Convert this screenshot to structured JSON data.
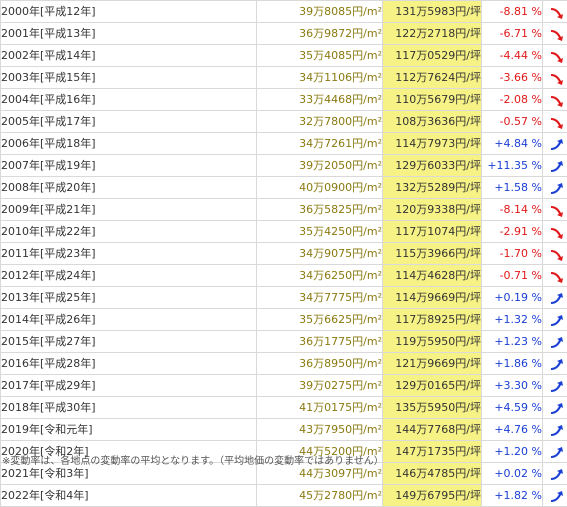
{
  "rows": [
    {
      "year": "2000年[平成12年]",
      "per_sqm": "39万8085円/m²",
      "per_tsubo": "131万5983円/坪",
      "rate": "-8.81 %",
      "trend": "down"
    },
    {
      "year": "2001年[平成13年]",
      "per_sqm": "36万9872円/m²",
      "per_tsubo": "122万2718円/坪",
      "rate": "-6.71 %",
      "trend": "down"
    },
    {
      "year": "2002年[平成14年]",
      "per_sqm": "35万4085円/m²",
      "per_tsubo": "117万0529円/坪",
      "rate": "-4.44 %",
      "trend": "down"
    },
    {
      "year": "2003年[平成15年]",
      "per_sqm": "34万1106円/m²",
      "per_tsubo": "112万7624円/坪",
      "rate": "-3.66 %",
      "trend": "down"
    },
    {
      "year": "2004年[平成16年]",
      "per_sqm": "33万4468円/m²",
      "per_tsubo": "110万5679円/坪",
      "rate": "-2.08 %",
      "trend": "down"
    },
    {
      "year": "2005年[平成17年]",
      "per_sqm": "32万7800円/m²",
      "per_tsubo": "108万3636円/坪",
      "rate": "-0.57 %",
      "trend": "down"
    },
    {
      "year": "2006年[平成18年]",
      "per_sqm": "34万7261円/m²",
      "per_tsubo": "114万7973円/坪",
      "rate": "+4.84 %",
      "trend": "up"
    },
    {
      "year": "2007年[平成19年]",
      "per_sqm": "39万2050円/m²",
      "per_tsubo": "129万6033円/坪",
      "rate": "+11.35 %",
      "trend": "up"
    },
    {
      "year": "2008年[平成20年]",
      "per_sqm": "40万0900円/m²",
      "per_tsubo": "132万5289円/坪",
      "rate": "+1.58 %",
      "trend": "up"
    },
    {
      "year": "2009年[平成21年]",
      "per_sqm": "36万5825円/m²",
      "per_tsubo": "120万9338円/坪",
      "rate": "-8.14 %",
      "trend": "down"
    },
    {
      "year": "2010年[平成22年]",
      "per_sqm": "35万4250円/m²",
      "per_tsubo": "117万1074円/坪",
      "rate": "-2.91 %",
      "trend": "down"
    },
    {
      "year": "2011年[平成23年]",
      "per_sqm": "34万9075円/m²",
      "per_tsubo": "115万3966円/坪",
      "rate": "-1.70 %",
      "trend": "down"
    },
    {
      "year": "2012年[平成24年]",
      "per_sqm": "34万6250円/m²",
      "per_tsubo": "114万4628円/坪",
      "rate": "-0.71 %",
      "trend": "down"
    },
    {
      "year": "2013年[平成25年]",
      "per_sqm": "34万7775円/m²",
      "per_tsubo": "114万9669円/坪",
      "rate": "+0.19 %",
      "trend": "up"
    },
    {
      "year": "2014年[平成26年]",
      "per_sqm": "35万6625円/m²",
      "per_tsubo": "117万8925円/坪",
      "rate": "+1.32 %",
      "trend": "up"
    },
    {
      "year": "2015年[平成27年]",
      "per_sqm": "36万1775円/m²",
      "per_tsubo": "119万5950円/坪",
      "rate": "+1.23 %",
      "trend": "up"
    },
    {
      "year": "2016年[平成28年]",
      "per_sqm": "36万8950円/m²",
      "per_tsubo": "121万9669円/坪",
      "rate": "+1.86 %",
      "trend": "up"
    },
    {
      "year": "2017年[平成29年]",
      "per_sqm": "39万0275円/m²",
      "per_tsubo": "129万0165円/坪",
      "rate": "+3.30 %",
      "trend": "up"
    },
    {
      "year": "2018年[平成30年]",
      "per_sqm": "41万0175円/m²",
      "per_tsubo": "135万5950円/坪",
      "rate": "+4.59 %",
      "trend": "up"
    },
    {
      "year": "2019年[令和元年]",
      "per_sqm": "43万7950円/m²",
      "per_tsubo": "144万7768円/坪",
      "rate": "+4.76 %",
      "trend": "up"
    },
    {
      "year": "2020年[令和2年]",
      "per_sqm": "44万5200円/m²",
      "per_tsubo": "147万1735円/坪",
      "rate": "+1.20 %",
      "trend": "up"
    },
    {
      "year": "2021年[令和3年]",
      "per_sqm": "44万3097円/m²",
      "per_tsubo": "146万4785円/坪",
      "rate": "+0.02 %",
      "trend": "up"
    },
    {
      "year": "2022年[令和4年]",
      "per_sqm": "45万2780円/m²",
      "per_tsubo": "149万6795円/坪",
      "rate": "+1.82 %",
      "trend": "up"
    }
  ],
  "note": "※変動率は、各地点の変動率の平均となります。（平均地価の変動率ではありません）",
  "colors": {
    "up": "#1a3fd4",
    "down": "#e0181a",
    "highlight": "#f7f286",
    "sqm_text": "#8a7a10"
  },
  "icons": {
    "up": "up-arrow-icon",
    "down": "down-arrow-icon"
  }
}
